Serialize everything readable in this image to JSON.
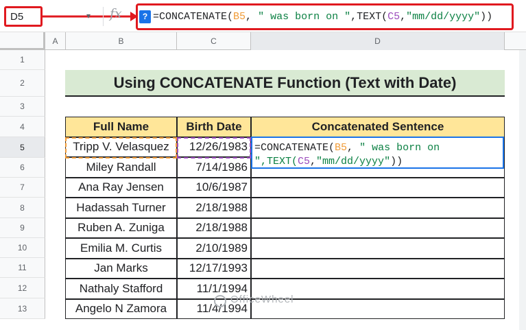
{
  "formula_bar": {
    "cell_ref": "D5",
    "fx_label": "fx",
    "help_label": "?",
    "formula_parts": [
      {
        "text": "=CONCATENATE(",
        "role": "func"
      },
      {
        "text": "B5",
        "role": "ref-b"
      },
      {
        "text": ", ",
        "role": "func"
      },
      {
        "text": "\" was born on \"",
        "role": "str"
      },
      {
        "text": ",TEXT(",
        "role": "func"
      },
      {
        "text": "C5",
        "role": "ref-c"
      },
      {
        "text": ",",
        "role": "func"
      },
      {
        "text": "\"mm/dd/yyyy\"",
        "role": "str"
      },
      {
        "text": "))",
        "role": "func"
      }
    ]
  },
  "columns": [
    "A",
    "B",
    "C",
    "D"
  ],
  "rows": [
    "1",
    "2",
    "3",
    "4",
    "5",
    "6",
    "7",
    "8",
    "9",
    "10",
    "11",
    "12",
    "13"
  ],
  "title": "Using CONCATENATE Function (Text with Date)",
  "table": {
    "headers": [
      "Full Name",
      "Birth Date",
      "Concatenated Sentence"
    ],
    "rows": [
      {
        "name": "Tripp V. Velasquez",
        "date": "12/26/1983"
      },
      {
        "name": "Miley Randall",
        "date": "7/14/1986"
      },
      {
        "name": "Ana Ray Jensen",
        "date": "10/6/1987"
      },
      {
        "name": "Hadassah Turner",
        "date": "2/18/1988"
      },
      {
        "name": "Ruben A. Zuniga",
        "date": "2/18/1988"
      },
      {
        "name": "Emilia M. Curtis",
        "date": "2/10/1989"
      },
      {
        "name": "Jan  Marks",
        "date": "12/17/1993"
      },
      {
        "name": "Nathaly Stafford",
        "date": "11/1/1994"
      },
      {
        "name": "Angelo N Zamora",
        "date": "11/4/1994"
      }
    ]
  },
  "editor": {
    "line1_parts": [
      {
        "text": "=CONCATENATE(",
        "role": "func"
      },
      {
        "text": "B5",
        "role": "ref-b"
      },
      {
        "text": ", ",
        "role": "func"
      },
      {
        "text": "\" was born on",
        "role": "str"
      }
    ],
    "line2_parts": [
      {
        "text": "\",TEXT(",
        "role": "str"
      },
      {
        "text": "C5",
        "role": "ref-c"
      },
      {
        "text": ",",
        "role": "func"
      },
      {
        "text": "\"mm/dd/yyyy\"",
        "role": "str"
      },
      {
        "text": "))",
        "role": "func"
      }
    ]
  },
  "watermark": "OfficeWheel",
  "colors": {
    "accent_red": "#e0191f",
    "ref_orange": "#f19c38",
    "ref_purple": "#9c4dbd",
    "header_fill": "#ffe699",
    "title_fill": "#d9ead3",
    "selection_blue": "#1a73e8"
  }
}
